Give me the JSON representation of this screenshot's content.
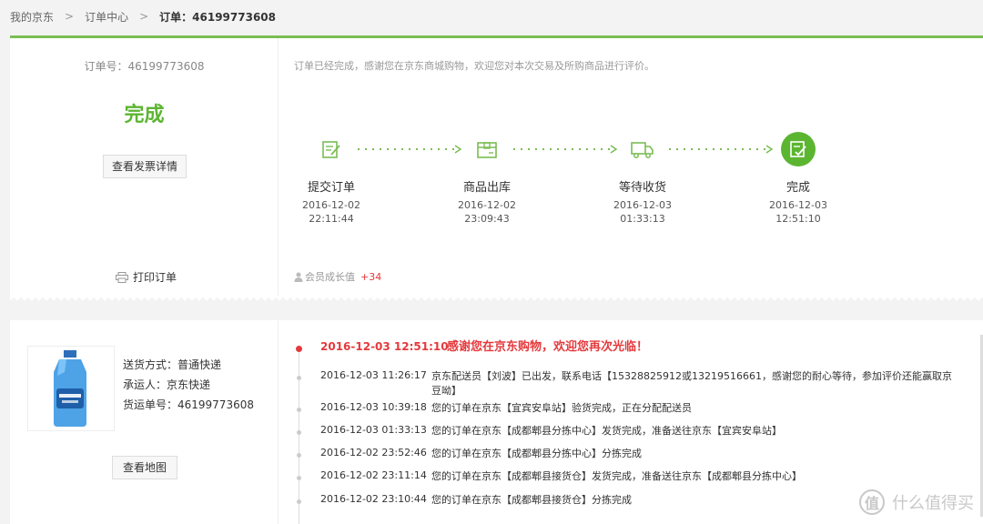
{
  "breadcrumb": {
    "home": "我的京东",
    "orders": "订单中心",
    "current": "订单：46199773608",
    "sep": ">"
  },
  "order": {
    "number_label": "订单号：46199773608",
    "status": "完成",
    "invoice_button": "查看发票详情",
    "print_label": "打印订单"
  },
  "progress": {
    "message": "订单已经完成，感谢您在京东商城购物，欢迎您对本次交易及所购商品进行评价。",
    "steps": [
      {
        "label": "提交订单",
        "date": "2016-12-02",
        "time": "22:11:44",
        "icon": "submit-order-icon"
      },
      {
        "label": "商品出库",
        "date": "2016-12-02",
        "time": "23:09:43",
        "icon": "package-out-icon"
      },
      {
        "label": "等待收货",
        "date": "2016-12-03",
        "time": "01:33:13",
        "icon": "delivery-truck-icon"
      },
      {
        "label": "完成",
        "date": "2016-12-03",
        "time": "12:51:10",
        "icon": "completed-icon"
      }
    ],
    "member_label": "会员成长值",
    "member_value": "+34"
  },
  "shipping": {
    "method": "送货方式：普通快递",
    "carrier": "承运人：京东快递",
    "tracking": "货运单号：46199773608",
    "map_button": "查看地图"
  },
  "timeline": [
    {
      "time": "2016-12-03 12:51:10",
      "text": "感谢您在京东购物，欢迎您再次光临！"
    },
    {
      "time": "2016-12-03 11:26:17",
      "text": "京东配送员【刘波】已出发，联系电话【15328825912或13219516661，感谢您的耐心等待，参加评价还能赢取京豆呦】"
    },
    {
      "time": "2016-12-03 10:39:18",
      "text": "您的订单在京东【宜宾安阜站】验货完成，正在分配配送员"
    },
    {
      "time": "2016-12-03 01:33:13",
      "text": "您的订单在京东【成都郫县分拣中心】发货完成，准备送往京东【宜宾安阜站】"
    },
    {
      "time": "2016-12-02 23:52:46",
      "text": "您的订单在京东【成都郫县分拣中心】分拣完成"
    },
    {
      "time": "2016-12-02 23:11:14",
      "text": "您的订单在京东【成都郫县接货仓】发货完成，准备送往京东【成都郫县分拣中心】"
    },
    {
      "time": "2016-12-02 23:10:44",
      "text": "您的订单在京东【成都郫县接货仓】分拣完成"
    }
  ],
  "watermark": {
    "icon_text": "值",
    "text": "什么值得买"
  },
  "colors": {
    "accent_green": "#5cb531",
    "alert_red": "#e4393c"
  }
}
